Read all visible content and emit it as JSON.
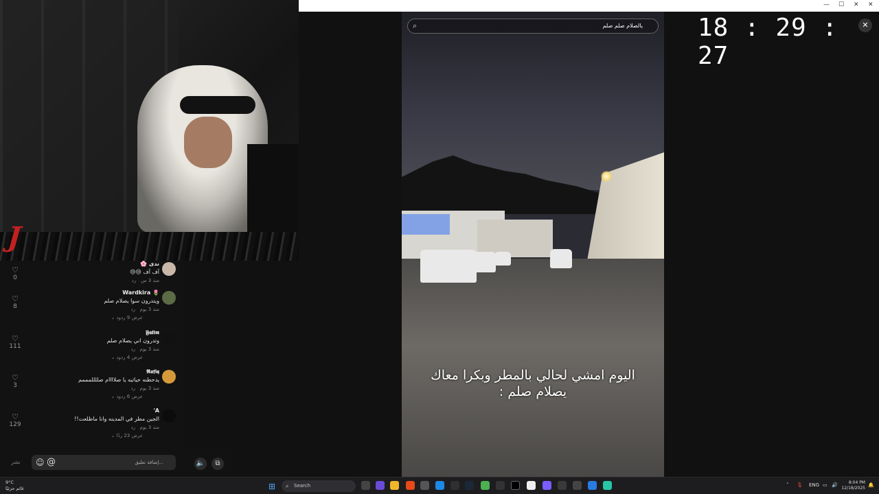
{
  "window": {
    "controls": [
      "—",
      "☐",
      "✕",
      "✕"
    ]
  },
  "comments": [
    {
      "user": "ندى 🌸",
      "text": "آف آف 😢😢",
      "time": "منذ 3 س",
      "reply": "رد",
      "view_replies": "",
      "likes": "0"
    },
    {
      "user": "🌷 Wardkira",
      "text": "ويتدرون سوا يصلام صلم",
      "time": "منذ 3 يوم",
      "reply": "رد",
      "view_replies": "عرض 9 ردود",
      "likes": "8"
    },
    {
      "user": "𝕱𝖆𝖙𝖎𝖒",
      "text": "وتدرون اني يصلام صلم",
      "time": "منذ 3 يوم",
      "reply": "رد",
      "view_replies": "عرض 4 ردود",
      "likes": "111"
    },
    {
      "user": "𝕽𝖆𝖋𝖎𝖖",
      "text": "يدحطنه حياتيه يا صلاااام صللللمممم",
      "time": "منذ 3 يوم",
      "reply": "رد",
      "view_replies": "عرض 6 ردود",
      "likes": "3"
    },
    {
      "user": "A'",
      "text": "الجين مطر في المدينه وانا ماطلعت!!",
      "time": "منذ 3 يوم",
      "reply": "رد",
      "view_replies": "عرض 23 ردًا",
      "likes": "129"
    }
  ],
  "comment_bar": {
    "placeholder": "إضافة تعليق...",
    "send": "نشر",
    "emoji": "☺",
    "mention": "@"
  },
  "video": {
    "search_query": "يالصلام صلم صلم",
    "caption_line1": "اليوم امشي لحالي بالمطر وبكرا معاك",
    "caption_line2": "يصلام صلم :"
  },
  "clock": {
    "time": "18 : 29 : 27"
  },
  "taskbar": {
    "weather_temp": "9°C",
    "weather_desc": "غائم جزئيًا",
    "search_label": "Search",
    "lang": "ENG",
    "time": "8:04 PM",
    "date": "12/18/2025"
  },
  "colors": {
    "accent": "#4ea8ff",
    "live_red": "#c32020"
  }
}
